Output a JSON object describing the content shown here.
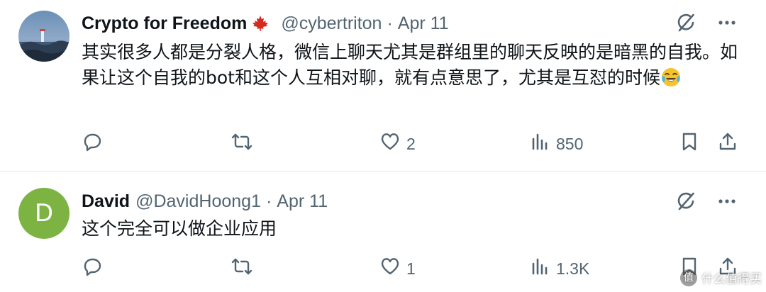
{
  "tweets": [
    {
      "display_name": "Crypto for Freedom",
      "flag_icon": "maple-leaf-icon",
      "handle": "@cybertriton",
      "separator": "·",
      "time": "Apr 11",
      "text": "其实很多人都是分裂人格，微信上聊天尤其是群组里的聊天反映的是暗黑的自我。如果让这个自我的bot和这个人互相对聊，就有点意思了，尤其是互怼的时候",
      "emoji_icon": "face-with-tears-of-joy-icon",
      "reply_count": "",
      "retweet_count": "",
      "like_count": "2",
      "view_count": "850"
    },
    {
      "display_name": "David",
      "avatar_letter": "D",
      "handle": "@DavidHoong1",
      "separator": "·",
      "time": "Apr 11",
      "text": "这个完全可以做企业应用",
      "reply_count": "",
      "retweet_count": "",
      "like_count": "1",
      "view_count": "1.3K"
    }
  ],
  "watermark": {
    "icon_text": "值",
    "text": "什么值得买"
  },
  "colors": {
    "text_primary": "#0f1419",
    "text_secondary": "#536471",
    "divider": "#eff3f4",
    "avatar_david": "#7cb342",
    "flag_red": "#d52b1e"
  }
}
